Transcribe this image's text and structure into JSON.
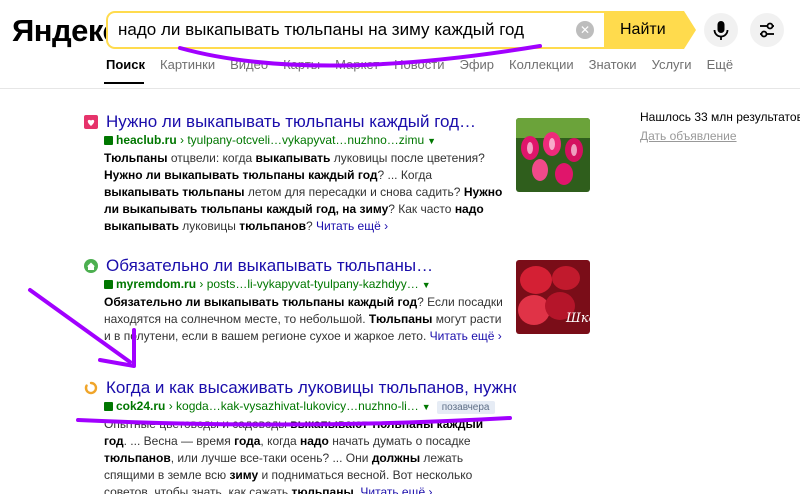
{
  "header": {
    "logo": "Яндекс",
    "search_value": "надо ли выкапывать тюльпаны на зиму каждый год",
    "find_label": "Найти",
    "clear_icon": "clear-icon",
    "mic_icon": "mic-icon",
    "settings_icon": "sliders-icon"
  },
  "tabs": [
    "Поиск",
    "Картинки",
    "Видео",
    "Карты",
    "Маркет",
    "Новости",
    "Эфир",
    "Коллекции",
    "Знатоки",
    "Услуги",
    "Ещё"
  ],
  "sidebar": {
    "results_count": "Нашлось 33 млн результатов",
    "ad_link": "Дать объявление"
  },
  "results": [
    {
      "title": "Нужно ли выкапывать тюльпаны каждый год…",
      "domain": "heaclub.ru",
      "path": " › tyulpany-otcveli…vykapyvat…nuzhno…zimu",
      "snippet": {
        "s1": "Тюльпаны",
        "s2": " отцвели: когда ",
        "s3": "выкапывать",
        "s4": " луковицы после цветения? ",
        "s5": "Нужно ли выкапывать тюльпаны каждый год",
        "s6": "? ... Когда ",
        "s7": "выкапывать тюльпаны",
        "s8": " летом для пересадки и снова садить? ",
        "s9": "Нужно ли выкапывать тюльпаны каждый год, на зиму",
        "s10": "? Как часто ",
        "s11": "надо выкапывать",
        "s12": " луковицы ",
        "s13": "тюльпанов",
        "s14": "? "
      },
      "more": "Читать ещё ›"
    },
    {
      "title": "Обязательно ли выкапывать тюльпаны…",
      "domain": "myremdom.ru",
      "path": " › posts…li-vykapyvat-tyulpany-kazhdyy…",
      "snippet": {
        "s1": "Обязательно ли выкапывать тюльпаны каждый год",
        "s2": "? Если посадки находятся на солнечном месте, то небольшой. ",
        "s3": "Тюльпаны",
        "s4": " могут расти и в полутени, если в вашем регионе сухое и жаркое лето."
      },
      "more": "Читать ещё ›",
      "thumb_caption": "Шко…"
    },
    {
      "title": "Когда и как высаживать луковицы тюльпанов, нужно ли…",
      "domain": "cok24.ru",
      "path": " › kogda…kak-vysazhivat-lukovicy…nuzhno-li…",
      "badge": "позавчера",
      "snippet": {
        "s1": "Опытные цветоводы и садоводы ",
        "s2": "выкапывают тюльпаны каждый год",
        "s3": ". ... Весна — время ",
        "s4": "года",
        "s5": ", когда ",
        "s6": "надо",
        "s7": " начать думать о посадке ",
        "s8": "тюльпанов",
        "s9": ", или лучше все-таки осень? ... Они ",
        "s10": "должны",
        "s11": " лежать спящими в земле всю ",
        "s12": "зиму",
        "s13": " и подниматься весной. Вот несколько советов, чтобы знать, как сажать ",
        "s14": "тюльпаны",
        "s15": ". "
      },
      "more": "Читать ещё ›"
    }
  ],
  "colors": {
    "brand_yellow": "#ffdb4d",
    "link": "#1a0dab",
    "url_green": "#007700",
    "annotation_purple": "#a100ff"
  }
}
